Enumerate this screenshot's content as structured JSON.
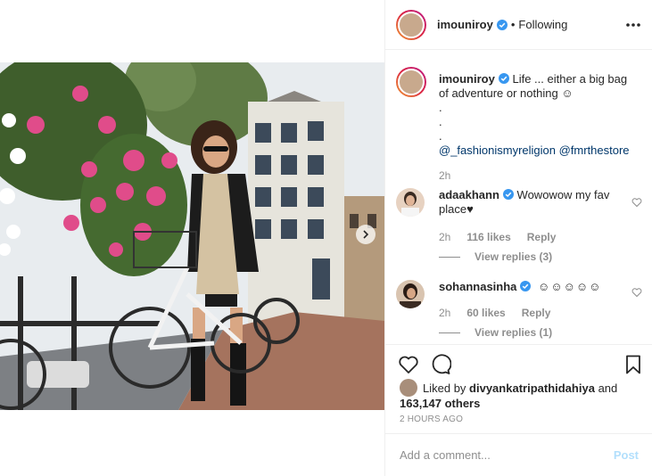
{
  "post": {
    "username": "imouniroy",
    "follow_separator": "•",
    "follow_status": "Following",
    "more_icon": "more-horizontal-icon",
    "next_icon": "chevron-right-icon"
  },
  "caption": {
    "username": "imouniroy",
    "text": "Life ... either a big bag of adventure or nothing ☺",
    "dots": [
      ".",
      ".",
      "."
    ],
    "mentions": "@_fashionismyreligion @fmrthestore",
    "time": "2h"
  },
  "comments": [
    {
      "username": "adaakhann",
      "text": "Wowowow my fav place♥",
      "time": "2h",
      "likes": "116 likes",
      "reply_label": "Reply",
      "view_replies": "View replies (3)"
    },
    {
      "username": "sohannasinha",
      "text": "☺☺☺☺☺",
      "time": "2h",
      "likes": "60 likes",
      "reply_label": "Reply",
      "view_replies": "View replies (1)"
    }
  ],
  "actions": {
    "like_icon": "heart-icon",
    "comment_icon": "comment-bubble-icon",
    "save_icon": "bookmark-icon"
  },
  "likes_summary": {
    "prefix": "Liked by",
    "user": "divyankatripathidahiya",
    "conjunction": "and",
    "others": "163,147 others"
  },
  "timestamp": "2 HOURS AGO",
  "comment_box": {
    "placeholder": "Add a comment...",
    "post_label": "Post"
  },
  "colors": {
    "link": "#00376b",
    "verified": "#3897f0",
    "muted": "#8e8e8e",
    "post_disabled": "#b2dffc"
  }
}
